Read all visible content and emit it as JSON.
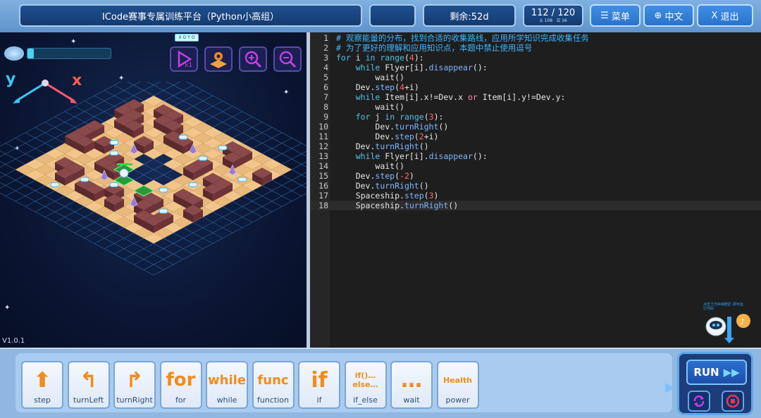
{
  "header": {
    "title": "ICode赛事专属训练平台（Python小高组）",
    "remaining": "剩余:52d",
    "progress_main": "112 / 120",
    "progress_sub_a": "108",
    "progress_sub_b": "16",
    "menu_label": "菜单",
    "lang_label": "中文",
    "exit_label": "退出"
  },
  "game": {
    "xoyo_label": "X O Y O",
    "axis_y": "y",
    "axis_x": "x",
    "version": "V1.0.1",
    "energy_level_percent": 8
  },
  "editor": {
    "lines": [
      {
        "n": "1",
        "indent": "",
        "segments": [
          {
            "t": "# 观察能量的分布，找到合适的收集路线，应用所学知识完成收集任务",
            "c": "cm"
          }
        ]
      },
      {
        "n": "2",
        "indent": "",
        "segments": [
          {
            "t": "# 为了更好的理解和应用知识点，本题中禁止使用逗号",
            "c": "cm"
          }
        ]
      },
      {
        "n": "3",
        "indent": "",
        "segments": [
          {
            "t": "for",
            "c": "kw"
          },
          {
            "t": " i ",
            "c": ""
          },
          {
            "t": "in",
            "c": "kw"
          },
          {
            "t": " ",
            "c": ""
          },
          {
            "t": "range",
            "c": "kw"
          },
          {
            "t": "(",
            "c": ""
          },
          {
            "t": "4",
            "c": "nm"
          },
          {
            "t": "):",
            "c": ""
          }
        ]
      },
      {
        "n": "4",
        "indent": "    ",
        "segments": [
          {
            "t": "while",
            "c": "kw"
          },
          {
            "t": " Flyer[i].",
            "c": ""
          },
          {
            "t": "disappear",
            "c": "fn"
          },
          {
            "t": "():",
            "c": ""
          }
        ]
      },
      {
        "n": "5",
        "indent": "        ",
        "segments": [
          {
            "t": "wait()",
            "c": ""
          }
        ]
      },
      {
        "n": "6",
        "indent": "    ",
        "segments": [
          {
            "t": "Dev.",
            "c": ""
          },
          {
            "t": "step",
            "c": "fn"
          },
          {
            "t": "(",
            "c": ""
          },
          {
            "t": "4",
            "c": "nm"
          },
          {
            "t": "+i)",
            "c": ""
          }
        ]
      },
      {
        "n": "7",
        "indent": "    ",
        "segments": [
          {
            "t": "while",
            "c": "kw"
          },
          {
            "t": " Item[i].x!=Dev.x ",
            "c": ""
          },
          {
            "t": "or",
            "c": "op"
          },
          {
            "t": " Item[i].y!=Dev.y:",
            "c": ""
          }
        ]
      },
      {
        "n": "8",
        "indent": "        ",
        "segments": [
          {
            "t": "wait()",
            "c": ""
          }
        ]
      },
      {
        "n": "9",
        "indent": "    ",
        "segments": [
          {
            "t": "for",
            "c": "kw"
          },
          {
            "t": " j ",
            "c": ""
          },
          {
            "t": "in",
            "c": "kw"
          },
          {
            "t": " ",
            "c": ""
          },
          {
            "t": "range",
            "c": "kw"
          },
          {
            "t": "(",
            "c": ""
          },
          {
            "t": "3",
            "c": "nm"
          },
          {
            "t": "):",
            "c": ""
          }
        ]
      },
      {
        "n": "10",
        "indent": "        ",
        "segments": [
          {
            "t": "Dev.",
            "c": ""
          },
          {
            "t": "turnRight",
            "c": "fn"
          },
          {
            "t": "()",
            "c": ""
          }
        ]
      },
      {
        "n": "11",
        "indent": "        ",
        "segments": [
          {
            "t": "Dev.",
            "c": ""
          },
          {
            "t": "step",
            "c": "fn"
          },
          {
            "t": "(",
            "c": ""
          },
          {
            "t": "2",
            "c": "nm"
          },
          {
            "t": "+i)",
            "c": ""
          }
        ]
      },
      {
        "n": "12",
        "indent": "    ",
        "segments": [
          {
            "t": "Dev.",
            "c": ""
          },
          {
            "t": "turnRight",
            "c": "fn"
          },
          {
            "t": "()",
            "c": ""
          }
        ]
      },
      {
        "n": "13",
        "indent": "    ",
        "segments": [
          {
            "t": "while",
            "c": "kw"
          },
          {
            "t": " Flyer[i].",
            "c": ""
          },
          {
            "t": "disappear",
            "c": "fn"
          },
          {
            "t": "():",
            "c": ""
          }
        ]
      },
      {
        "n": "14",
        "indent": "        ",
        "segments": [
          {
            "t": "wait()",
            "c": ""
          }
        ]
      },
      {
        "n": "15",
        "indent": "    ",
        "segments": [
          {
            "t": "Dev.",
            "c": ""
          },
          {
            "t": "step",
            "c": "fn"
          },
          {
            "t": "(",
            "c": ""
          },
          {
            "t": "-2",
            "c": "nm"
          },
          {
            "t": ")",
            "c": ""
          }
        ]
      },
      {
        "n": "16",
        "indent": "    ",
        "segments": [
          {
            "t": "Dev.",
            "c": ""
          },
          {
            "t": "turnRight",
            "c": "fn"
          },
          {
            "t": "()",
            "c": ""
          }
        ]
      },
      {
        "n": "17",
        "indent": "    ",
        "segments": [
          {
            "t": "Spaceship.",
            "c": ""
          },
          {
            "t": "step",
            "c": "fn"
          },
          {
            "t": "(",
            "c": ""
          },
          {
            "t": "3",
            "c": "nm"
          },
          {
            "t": ")",
            "c": ""
          }
        ]
      },
      {
        "n": "18",
        "indent": "    ",
        "segments": [
          {
            "t": "Spaceship.",
            "c": ""
          },
          {
            "t": "turnRight",
            "c": "fn"
          },
          {
            "t": "()",
            "c": ""
          }
        ]
      }
    ],
    "helper_text": "点击下方RUN按钮 即可运行代码"
  },
  "palette": {
    "blocks": [
      {
        "label": "step",
        "icon": "step-icon",
        "glyph": "⬆"
      },
      {
        "label": "turnLeft",
        "icon": "turn-left-icon",
        "glyph": "↰"
      },
      {
        "label": "turnRight",
        "icon": "turn-right-icon",
        "glyph": "↱"
      },
      {
        "label": "for",
        "icon": "for-icon",
        "glyph": "for"
      },
      {
        "label": "while",
        "icon": "while-icon",
        "glyph": "while"
      },
      {
        "label": "function",
        "icon": "func-icon",
        "glyph": "func"
      },
      {
        "label": "if",
        "icon": "if-icon",
        "glyph": "if"
      },
      {
        "label": "if_else",
        "icon": "if-else-icon",
        "glyph": "if()…\nelse…"
      },
      {
        "label": "wait",
        "icon": "wait-icon",
        "glyph": "…"
      },
      {
        "label": "power",
        "icon": "power-icon",
        "glyph": "Health"
      }
    ],
    "run_label": "RUN"
  }
}
